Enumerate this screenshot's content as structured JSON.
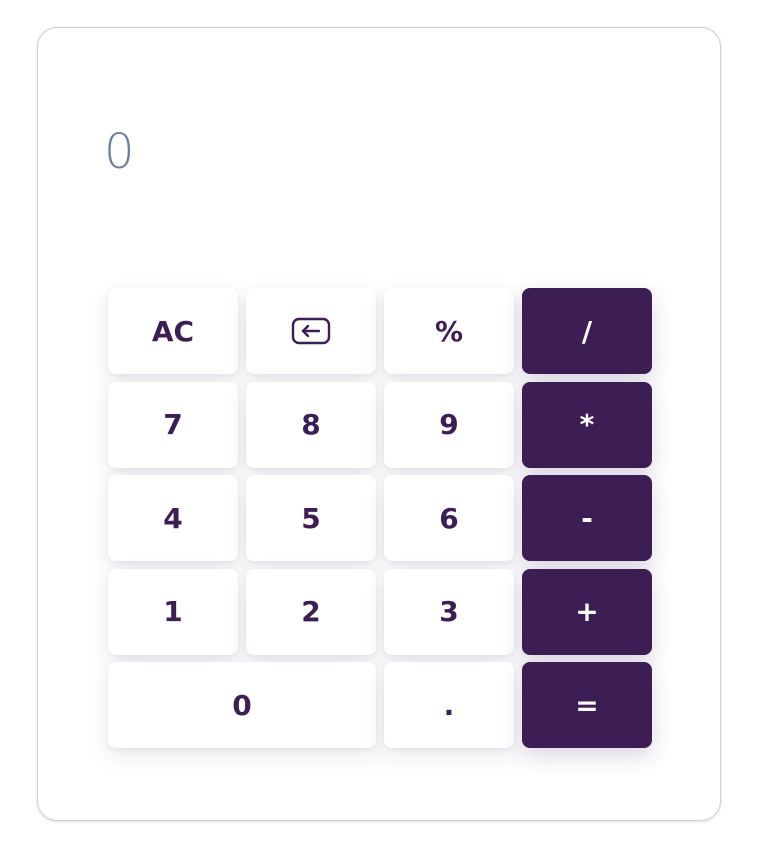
{
  "display": {
    "value": "0"
  },
  "colors": {
    "accent": "#3c1e55",
    "key_text": "#3d1d55",
    "display_text": "#70809a",
    "key_background": "#ffffff"
  },
  "keys": {
    "clear": "AC",
    "backspace_icon": "backspace-icon",
    "percent": "%",
    "divide": "/",
    "seven": "7",
    "eight": "8",
    "nine": "9",
    "multiply": "*",
    "four": "4",
    "five": "5",
    "six": "6",
    "subtract": "-",
    "one": "1",
    "two": "2",
    "three": "3",
    "add": "+",
    "zero": "0",
    "decimal": ".",
    "equals": "="
  }
}
